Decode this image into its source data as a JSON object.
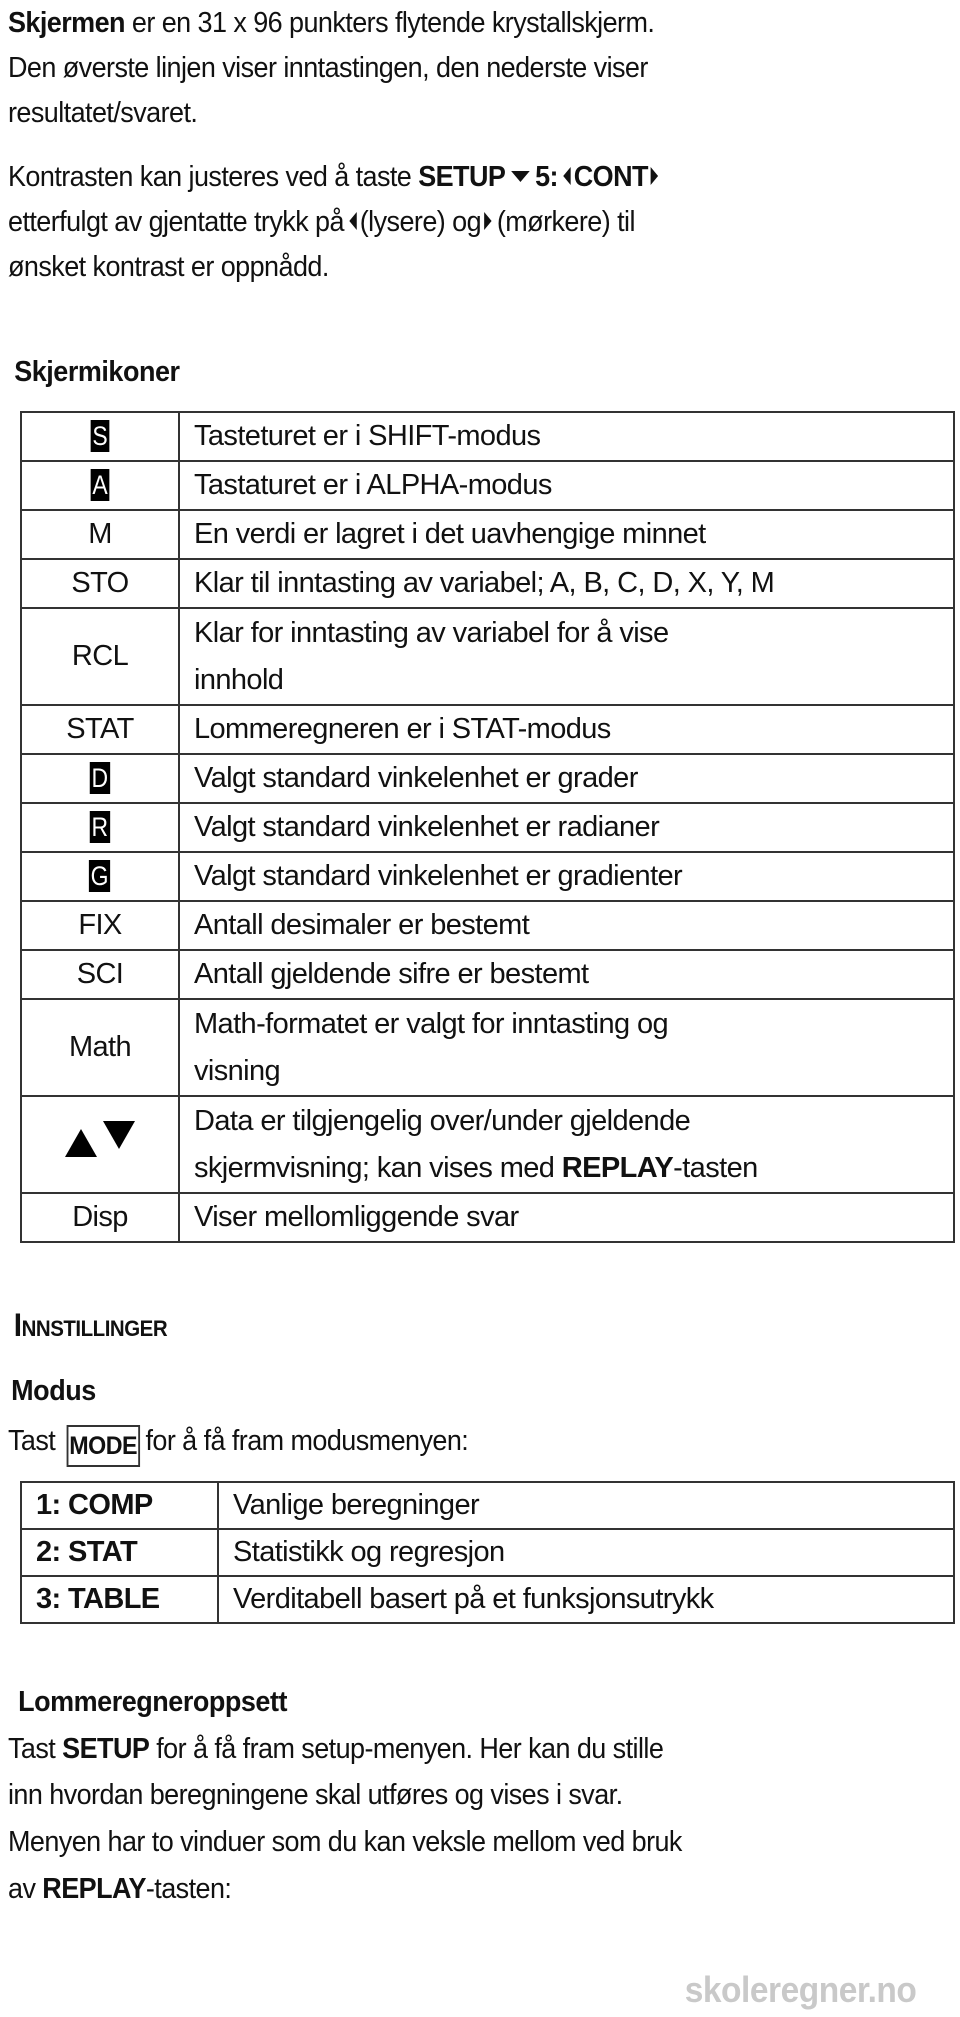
{
  "intro": {
    "p1": {
      "bold": "Skjermen",
      "line1_rest": " er en 31 x 96 punkters flytende krystallskjerm.",
      "line2": "Den øverste linjen viser inntastingen, den nederste viser",
      "line3": "resultatet/svaret."
    },
    "p2": {
      "line1_prefix": "Kontrasten kan justeres ved å taste ",
      "key_setup": "SETUP",
      "key_5": "5:",
      "key_cont": "CONT",
      "line2_a": "etterfulgt av gjentatte trykk på",
      "line2_b": "(lysere) og",
      "line2_c": "(mørkere) til",
      "line3": "ønsket kontrast er oppnådd."
    }
  },
  "icons_section": {
    "title": "Skjermikoner",
    "rows": [
      {
        "symbol": "S",
        "inverse": true,
        "desc": "Tasteturet er i SHIFT-modus"
      },
      {
        "symbol": "A",
        "inverse": true,
        "desc": "Tastaturet er i ALPHA-modus"
      },
      {
        "symbol": "M",
        "inverse": false,
        "desc": "En verdi er lagret i det uavhengige minnet"
      },
      {
        "symbol": "STO",
        "inverse": false,
        "desc": "Klar til inntasting av variabel; A, B, C, D, X, Y, M"
      },
      {
        "symbol": "RCL",
        "inverse": false,
        "desc_line1": "Klar for inntasting av variabel for å vise",
        "desc_line2": "innhold"
      },
      {
        "symbol": "STAT",
        "inverse": false,
        "desc": "Lommeregneren er i STAT-modus"
      },
      {
        "symbol": "D",
        "inverse": true,
        "desc": "Valgt standard vinkelenhet er grader"
      },
      {
        "symbol": "R",
        "inverse": true,
        "desc": "Valgt standard vinkelenhet er radianer"
      },
      {
        "symbol": "G",
        "inverse": true,
        "desc": "Valgt standard vinkelenhet er gradienter"
      },
      {
        "symbol": "FIX",
        "inverse": false,
        "desc": "Antall desimaler er bestemt"
      },
      {
        "symbol": "SCI",
        "inverse": false,
        "desc": "Antall gjeldende sifre er bestemt"
      },
      {
        "symbol": "Math",
        "inverse": false,
        "desc_line1": "Math-formatet er valgt for inntasting og",
        "desc_line2": "visning"
      },
      {
        "symbol": "up-down-arrows",
        "inverse": false,
        "desc_line1": "Data er tilgjengelig over/under gjeldende",
        "desc_line2_prefix": "skjermvisning; kan vises med ",
        "desc_line2_bold": "REPLAY",
        "desc_line2_suffix": "-tasten"
      },
      {
        "symbol": "Disp",
        "inverse": false,
        "desc": "Viser mellomliggende svar"
      }
    ]
  },
  "settings": {
    "title": "Innstillinger",
    "mode": {
      "heading": "Modus",
      "intro_prefix": "Tast",
      "key": "MODE",
      "intro_suffix": "for å få fram modusmenyen:",
      "rows": [
        {
          "key": "1: COMP",
          "desc": "Vanlige beregninger"
        },
        {
          "key": "2: STAT",
          "desc": "Statistikk og regresjon"
        },
        {
          "key": "3: TABLE",
          "desc": "Verditabell basert på et funksjonsutrykk"
        }
      ]
    },
    "setup": {
      "heading": "Lommeregneroppsett",
      "line1_prefix": "Tast ",
      "line1_bold": "SETUP",
      "line1_rest": " for å få fram setup-menyen. Her kan du stille",
      "line2": "inn hvordan beregningene skal utføres og vises i svar.",
      "line3": "Menyen har to vinduer som du kan veksle mellom ved bruk",
      "line4_prefix": "av ",
      "line4_bold": "REPLAY",
      "line4_suffix": "-tasten:"
    }
  },
  "watermark": "skoleregner.no"
}
